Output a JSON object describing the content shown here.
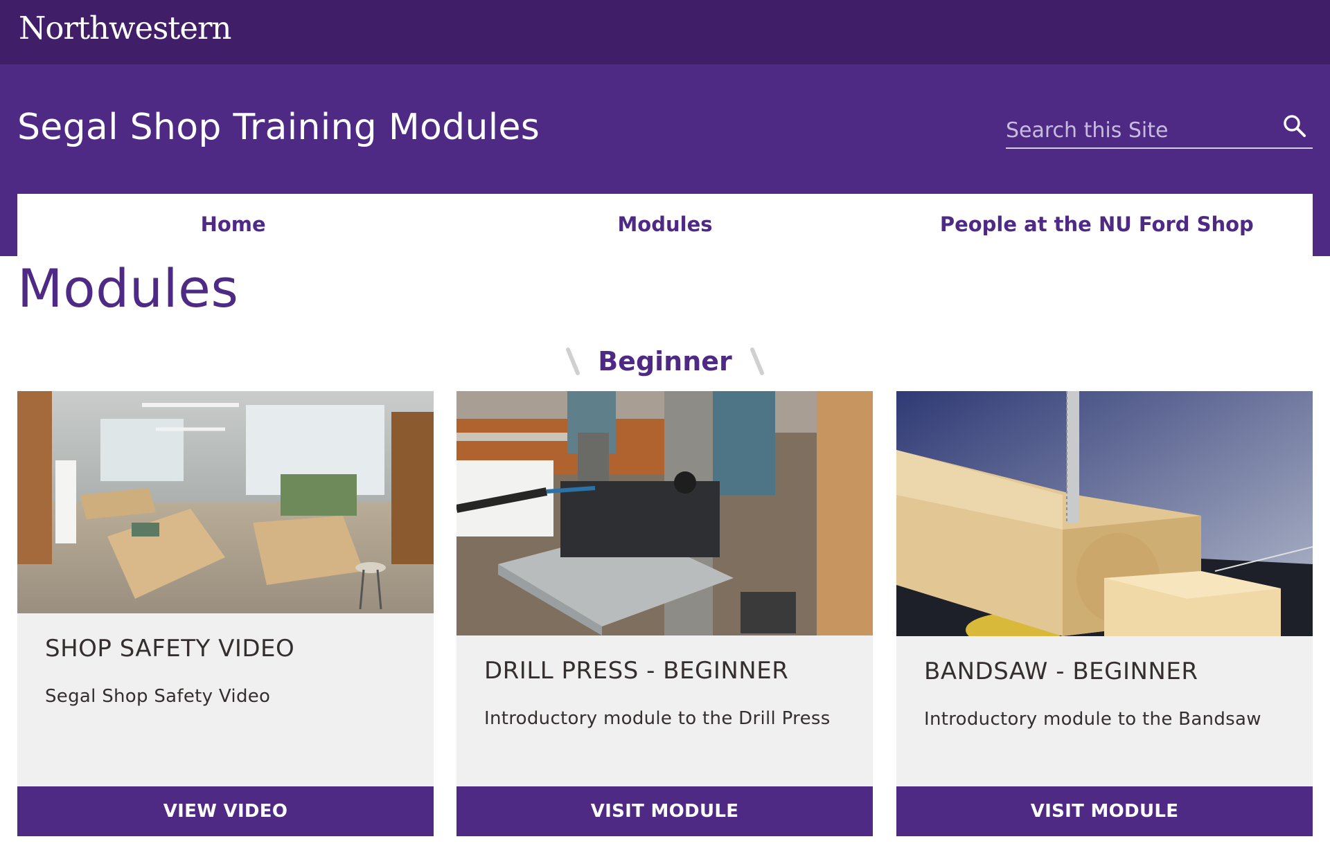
{
  "brand": {
    "logo_text": "Northwestern"
  },
  "header": {
    "site_title": "Segal Shop Training Modules",
    "search_placeholder": "Search this Site",
    "search_icon": "search-icon"
  },
  "nav": {
    "items": [
      {
        "label": "Home"
      },
      {
        "label": "Modules"
      },
      {
        "label": "People at the NU Ford Shop"
      }
    ]
  },
  "page": {
    "title": "Modules"
  },
  "section": {
    "title": "Beginner"
  },
  "cards": [
    {
      "title": "SHOP SAFETY VIDEO",
      "description": "Segal Shop Safety Video",
      "button": "VIEW VIDEO",
      "image": "shop-interior-photo"
    },
    {
      "title": "DRILL PRESS - BEGINNER",
      "description": "Introductory module to the Drill Press",
      "button": "VISIT MODULE",
      "image": "drill-press-photo"
    },
    {
      "title": "BANDSAW - BEGINNER",
      "description": "Introductory module to the Bandsaw",
      "button": "VISIT MODULE",
      "image": "bandsaw-photo"
    }
  ],
  "colors": {
    "brand_dark": "#401f68",
    "brand_purple": "#4e2a84",
    "card_bg": "#f0f0f0",
    "text": "#342f2e"
  }
}
